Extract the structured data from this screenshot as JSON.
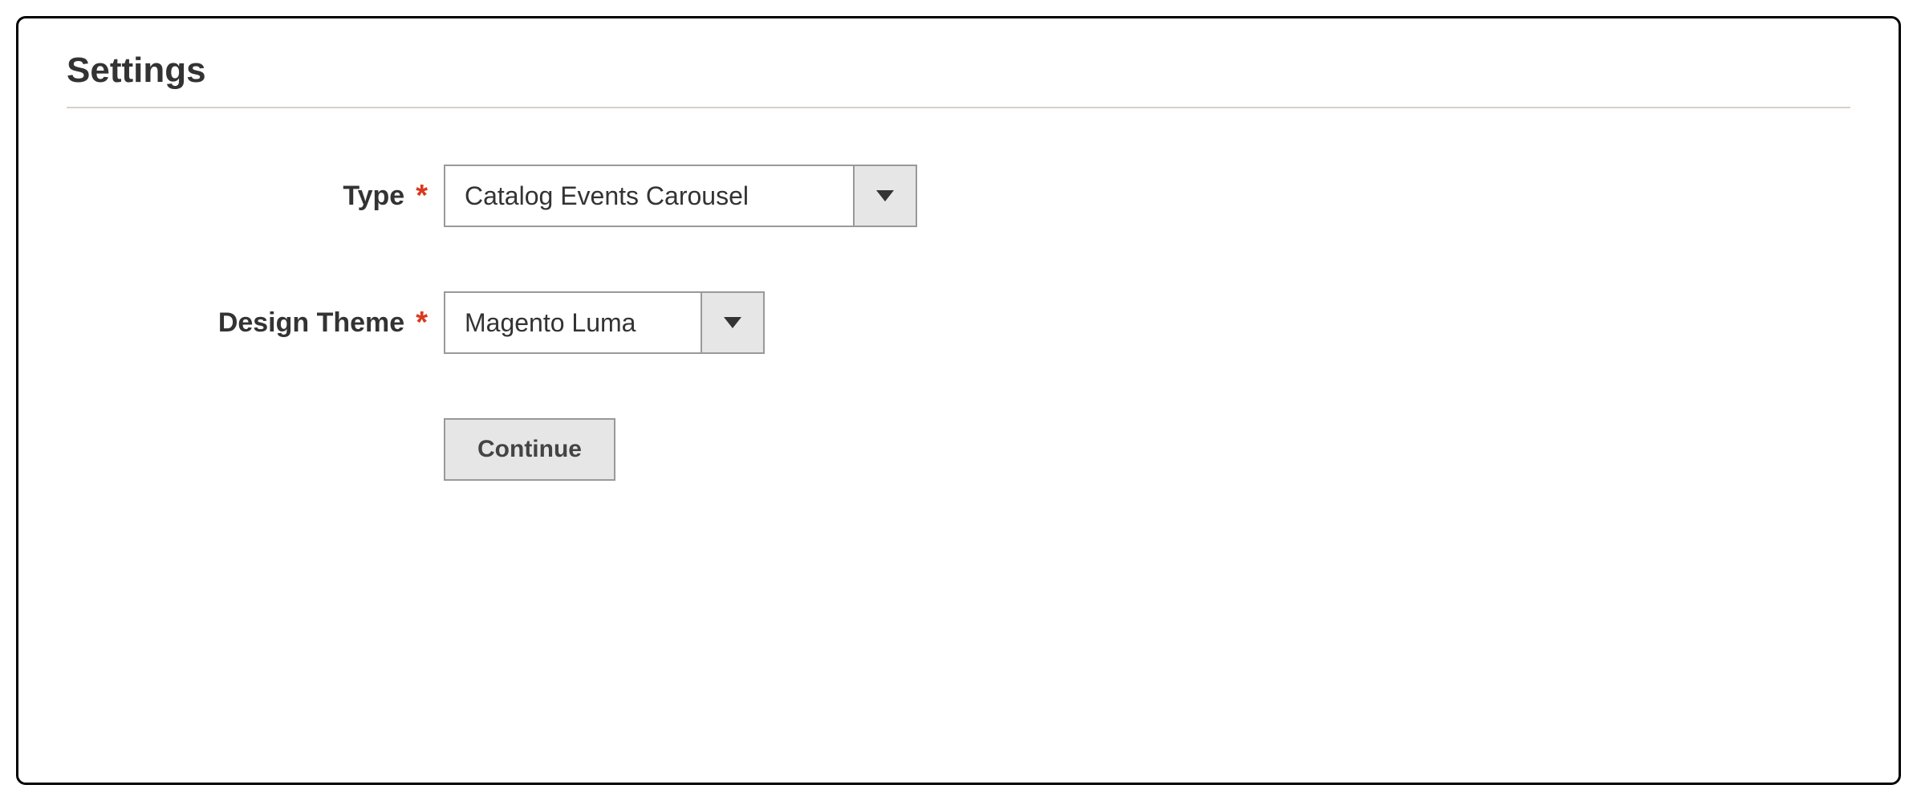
{
  "section": {
    "title": "Settings"
  },
  "fields": {
    "type": {
      "label": "Type",
      "required_mark": "*",
      "value": "Catalog Events Carousel"
    },
    "design_theme": {
      "label": "Design Theme",
      "required_mark": "*",
      "value": "Magento Luma"
    }
  },
  "actions": {
    "continue_label": "Continue"
  }
}
